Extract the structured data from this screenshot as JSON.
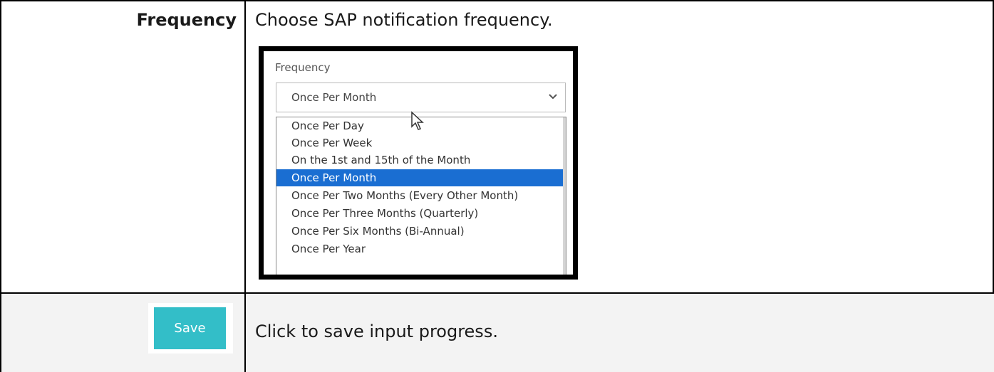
{
  "rows": [
    {
      "label": "Frequency",
      "description": "Choose SAP notification frequency.",
      "screenshot": {
        "field_label": "Frequency",
        "selected_value": "Once Per Month",
        "options": [
          "Once Per Day",
          "Once Per Week",
          "On the 1st and 15th of the Month",
          "Once Per Month",
          "Once Per Two Months (Every Other Month)",
          "Once Per Three Months (Quarterly)",
          "Once Per Six Months (Bi-Annual)",
          "Once Per Year"
        ],
        "highlighted_index": 3,
        "highlight_color": "#1a6ed2"
      }
    },
    {
      "button_label": "Save",
      "button_color": "#33bec8",
      "description": "Click to save input progress."
    }
  ],
  "icons": {
    "dropdown": "chevron-down-icon",
    "pointer": "mouse-cursor-icon"
  }
}
